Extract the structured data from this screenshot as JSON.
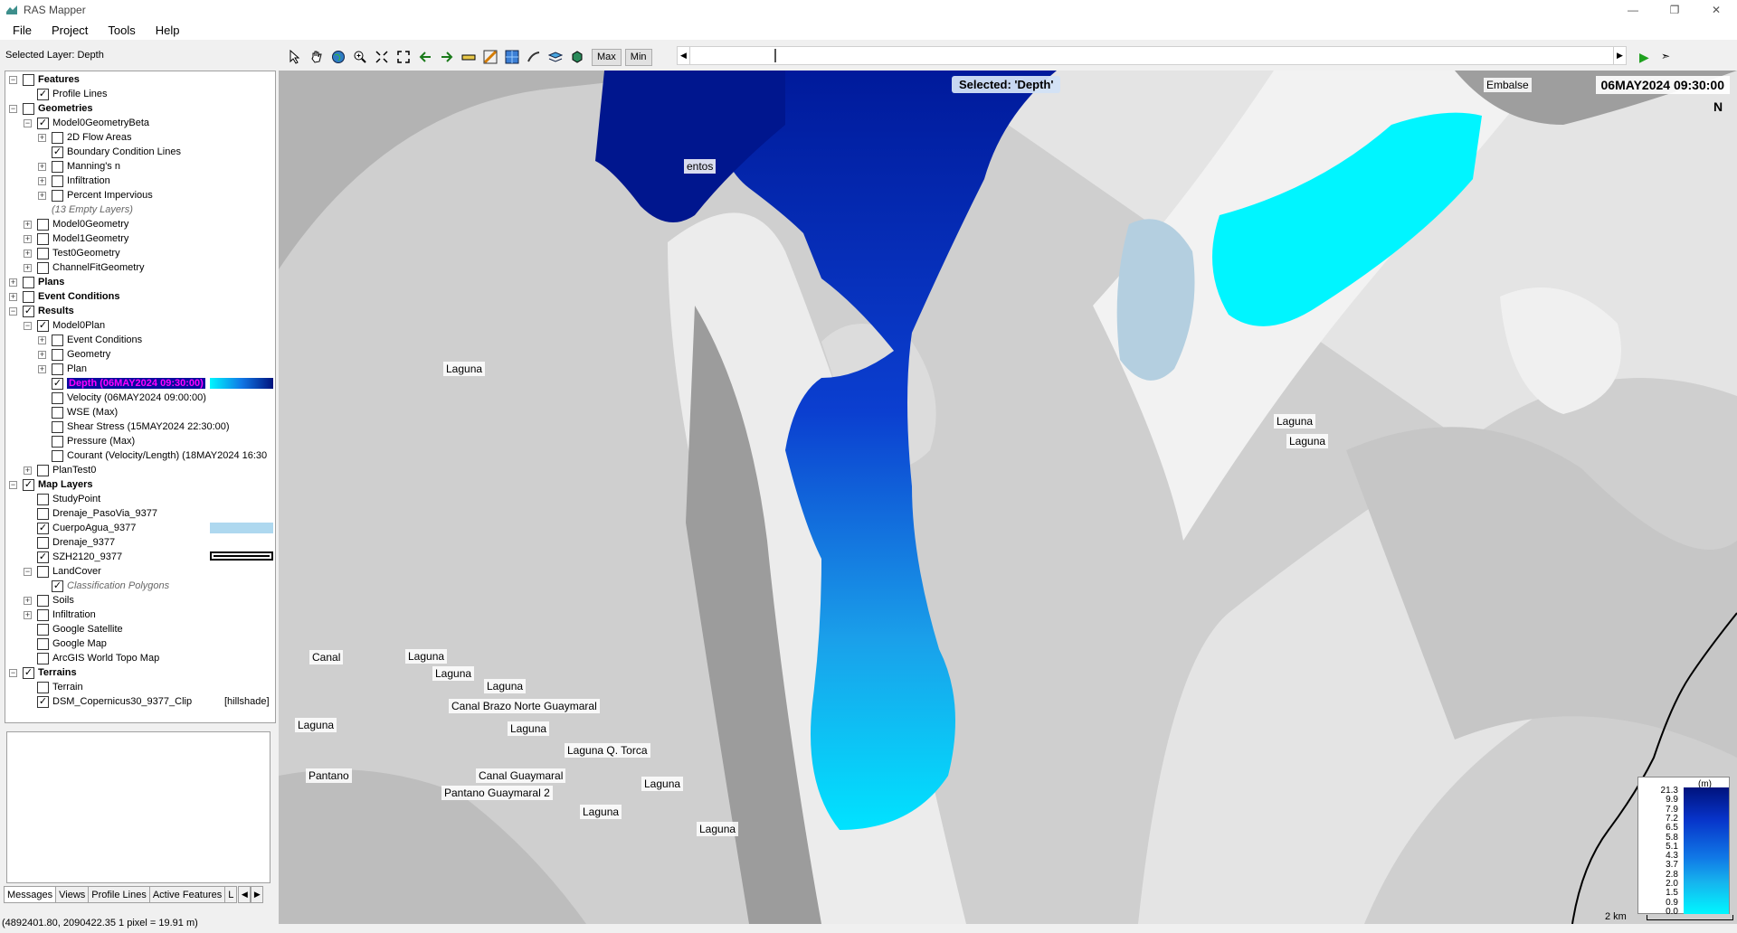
{
  "window": {
    "title": "RAS Mapper"
  },
  "menu": [
    "File",
    "Project",
    "Tools",
    "Help"
  ],
  "selected_layer_text": "Selected Layer: Depth",
  "toolbar": {
    "tools": [
      "select-arrow-icon",
      "pan-hand-icon",
      "globe-icon",
      "zoom-in-icon",
      "zoom-extent-icon",
      "full-extent-icon",
      "back-arrow-icon",
      "forward-arrow-icon",
      "measure-ruler-icon",
      "color-ramp-icon",
      "raster-icon",
      "profile-tool-icon",
      "layers-icon",
      "3d-view-icon"
    ],
    "max_label": "Max",
    "min_label": "Min"
  },
  "layer_tree": [
    {
      "level": 0,
      "expander": "−",
      "checked": false,
      "label": "Features",
      "style": "bold"
    },
    {
      "level": 1,
      "expander": "",
      "checked": true,
      "label": "Profile Lines"
    },
    {
      "level": 0,
      "expander": "−",
      "checked": false,
      "label": "Geometries",
      "style": "bold"
    },
    {
      "level": 1,
      "expander": "−",
      "checked": true,
      "label": "Model0GeometryBeta"
    },
    {
      "level": 2,
      "expander": "+",
      "checked": false,
      "label": "2D Flow Areas"
    },
    {
      "level": 2,
      "expander": "",
      "checked": true,
      "label": "Boundary Condition Lines"
    },
    {
      "level": 2,
      "expander": "+",
      "checked": false,
      "label": "Manning's n"
    },
    {
      "level": 2,
      "expander": "+",
      "checked": false,
      "label": "Infiltration"
    },
    {
      "level": 2,
      "expander": "+",
      "checked": false,
      "label": "Percent Impervious"
    },
    {
      "level": 2,
      "expander": "none",
      "checked": null,
      "label": "(13 Empty Layers)",
      "style": "italic"
    },
    {
      "level": 1,
      "expander": "+",
      "checked": false,
      "label": "Model0Geometry"
    },
    {
      "level": 1,
      "expander": "+",
      "checked": false,
      "label": "Model1Geometry"
    },
    {
      "level": 1,
      "expander": "+",
      "checked": false,
      "label": "Test0Geometry"
    },
    {
      "level": 1,
      "expander": "+",
      "checked": false,
      "label": "ChannelFitGeometry"
    },
    {
      "level": 0,
      "expander": "+",
      "checked": false,
      "label": "Plans",
      "style": "bold"
    },
    {
      "level": 0,
      "expander": "+",
      "checked": false,
      "label": "Event Conditions",
      "style": "bold"
    },
    {
      "level": 0,
      "expander": "−",
      "checked": true,
      "label": "Results",
      "style": "bold"
    },
    {
      "level": 1,
      "expander": "−",
      "checked": true,
      "label": "Model0Plan"
    },
    {
      "level": 2,
      "expander": "+",
      "checked": false,
      "label": "Event Conditions"
    },
    {
      "level": 2,
      "expander": "+",
      "checked": false,
      "label": "Geometry"
    },
    {
      "level": 2,
      "expander": "+",
      "checked": false,
      "label": "Plan"
    },
    {
      "level": 2,
      "expander": "",
      "checked": true,
      "label": "Depth (06MAY2024 09:30:00)",
      "style": "highlight",
      "swatch": "depth"
    },
    {
      "level": 2,
      "expander": "",
      "checked": false,
      "label": "Velocity (06MAY2024 09:00:00)"
    },
    {
      "level": 2,
      "expander": "",
      "checked": false,
      "label": "WSE (Max)"
    },
    {
      "level": 2,
      "expander": "",
      "checked": false,
      "label": "Shear Stress (15MAY2024 22:30:00)"
    },
    {
      "level": 2,
      "expander": "",
      "checked": false,
      "label": "Pressure (Max)"
    },
    {
      "level": 2,
      "expander": "",
      "checked": false,
      "label": "Courant (Velocity/Length) (18MAY2024 16:30"
    },
    {
      "level": 1,
      "expander": "+",
      "checked": false,
      "label": "PlanTest0"
    },
    {
      "level": 0,
      "expander": "−",
      "checked": true,
      "label": "Map Layers",
      "style": "bold"
    },
    {
      "level": 1,
      "expander": "",
      "checked": false,
      "label": "StudyPoint"
    },
    {
      "level": 1,
      "expander": "",
      "checked": false,
      "label": "Drenaje_PasoVia_9377"
    },
    {
      "level": 1,
      "expander": "",
      "checked": true,
      "label": "CuerpoAgua_9377",
      "swatch": "water"
    },
    {
      "level": 1,
      "expander": "",
      "checked": false,
      "label": "Drenaje_9377"
    },
    {
      "level": 1,
      "expander": "",
      "checked": true,
      "label": "SZH2120_9377",
      "swatch": "outline"
    },
    {
      "level": 1,
      "expander": "−",
      "checked": false,
      "label": "LandCover"
    },
    {
      "level": 2,
      "expander": "",
      "checked": true,
      "label": "Classification Polygons",
      "style": "italic"
    },
    {
      "level": 1,
      "expander": "+",
      "checked": false,
      "label": "Soils"
    },
    {
      "level": 1,
      "expander": "+",
      "checked": false,
      "label": "Infiltration"
    },
    {
      "level": 1,
      "expander": "",
      "checked": false,
      "label": "Google Satellite"
    },
    {
      "level": 1,
      "expander": "",
      "checked": false,
      "label": "Google Map"
    },
    {
      "level": 1,
      "expander": "",
      "checked": false,
      "label": "ArcGIS World Topo Map"
    },
    {
      "level": 0,
      "expander": "−",
      "checked": true,
      "label": "Terrains",
      "style": "bold"
    },
    {
      "level": 1,
      "expander": "",
      "checked": false,
      "label": "Terrain"
    },
    {
      "level": 1,
      "expander": "",
      "checked": true,
      "label": "DSM_Copernicus30_9377_Clip",
      "suffix": "[hillshade]"
    }
  ],
  "tabs": [
    "Messages",
    "Views",
    "Profile Lines",
    "Active Features",
    "L"
  ],
  "status_text": "(4892401.80, 2090422.35  1 pixel = 19.91 m)",
  "map": {
    "selected_banner": "Selected: 'Depth'",
    "time_label": "06MAY2024 09:30:00",
    "north_label": "N",
    "labels": [
      {
        "text": "Laguna",
        "name": "map-label-laguna-1"
      },
      {
        "text": "Embalse",
        "name": "map-label-embalse"
      },
      {
        "text": "Laguna",
        "name": "map-label-laguna-2"
      },
      {
        "text": "Laguna",
        "name": "map-label-laguna-3"
      },
      {
        "text": "Canal",
        "name": "map-label-canal"
      },
      {
        "text": "Laguna",
        "name": "map-label-laguna-4"
      },
      {
        "text": "Laguna",
        "name": "map-label-laguna-5"
      },
      {
        "text": "Laguna",
        "name": "map-label-laguna-6"
      },
      {
        "text": "Canal Brazo Norte Guaymaral",
        "name": "map-label-canal-brazo"
      },
      {
        "text": "Laguna",
        "name": "map-label-laguna-7"
      },
      {
        "text": "Laguna Q. Torca",
        "name": "map-label-laguna-torca"
      },
      {
        "text": "Laguna",
        "name": "map-label-laguna-8"
      },
      {
        "text": "Pantano",
        "name": "map-label-pantano"
      },
      {
        "text": "Canal Guaymaral",
        "name": "map-label-canal-guaymaral"
      },
      {
        "text": "Pantano Guaymaral 2",
        "name": "map-label-pantano-2"
      },
      {
        "text": "Laguna",
        "name": "map-label-laguna-9"
      },
      {
        "text": "Laguna",
        "name": "map-label-laguna-10"
      },
      {
        "text": "Laguna",
        "name": "map-label-laguna-11"
      },
      {
        "text": "entos",
        "name": "map-label-entos"
      }
    ],
    "legend": {
      "unit": "(m)",
      "ticks": [
        "21.3",
        "9.9",
        "7.9",
        "7.2",
        "6.5",
        "5.8",
        "5.1",
        "4.3",
        "3.7",
        "2.8",
        "2.0",
        "1.5",
        "0.9",
        "0.0"
      ]
    },
    "scale_label": "2 km",
    "colors": {
      "depth_deep": "#00137d",
      "depth_mid": "#1077e6",
      "depth_shallow": "#00f7ff",
      "water_body": "#aed8ef"
    }
  }
}
